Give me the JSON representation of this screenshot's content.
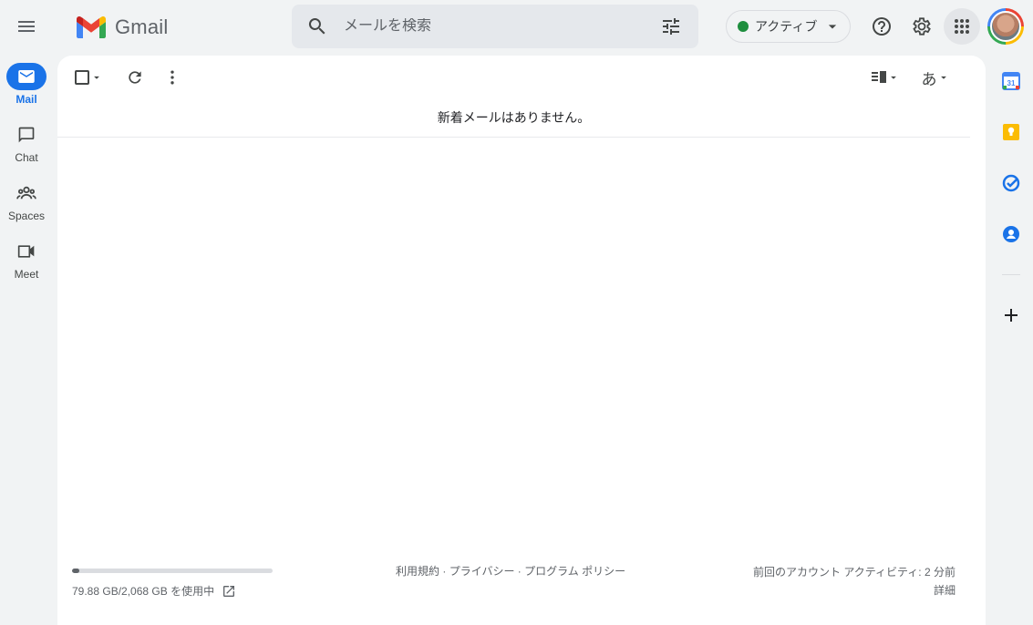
{
  "header": {
    "app_name": "Gmail",
    "search_placeholder": "メールを検索",
    "status_label": "アクティブ"
  },
  "nav": {
    "items": [
      {
        "label": "Mail",
        "icon": "mail-icon",
        "active": true
      },
      {
        "label": "Chat",
        "icon": "chat-icon",
        "active": false
      },
      {
        "label": "Spaces",
        "icon": "spaces-icon",
        "active": false
      },
      {
        "label": "Meet",
        "icon": "meet-icon",
        "active": false
      }
    ]
  },
  "main": {
    "empty_message": "新着メールはありません。",
    "input_tool_label": "あ",
    "storage": {
      "text": "79.88 GB/2,068 GB を使用中",
      "fraction_used": 0.0386
    },
    "footer": {
      "terms": "利用規約",
      "privacy": "プライバシー",
      "program_policies": "プログラム ポリシー",
      "separator": " · ",
      "last_activity": "前回のアカウント アクティビティ: 2 分前",
      "details": "詳細"
    }
  },
  "side_panel": {
    "calendar_day": "31",
    "apps": [
      "calendar-icon",
      "keep-icon",
      "tasks-icon",
      "contacts-icon",
      "add-icon"
    ]
  },
  "colors": {
    "accent": "#1a73e8",
    "status_active": "#1e8e3e",
    "background": "#f1f3f4"
  }
}
